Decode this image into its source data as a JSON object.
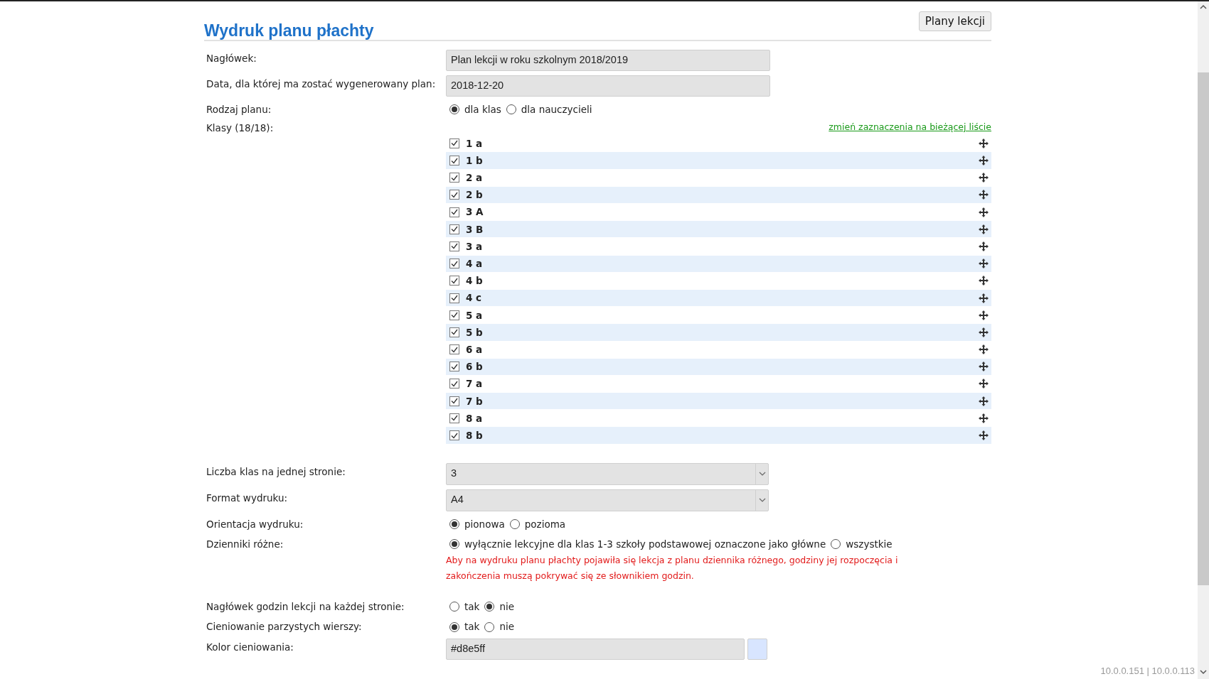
{
  "title": "Wydruk planu płachty",
  "top_button": "Plany lekcji",
  "form": [
    {
      "kind": "text",
      "label": "Nagłówek:",
      "value": "Plan lekcji w roku szkolnym 2018/2019"
    },
    {
      "kind": "text",
      "label": "Data, dla której ma zostać wygenerowany plan:",
      "value": "2018-12-20"
    },
    {
      "kind": "radio",
      "label": "Rodzaj planu:",
      "options": [
        {
          "label": "dla klas",
          "selected": true
        },
        {
          "label": "dla nauczycieli",
          "selected": false
        }
      ]
    },
    {
      "kind": "checklist",
      "label": "Klasy (18/18):",
      "link": "zmień zaznaczenia na bieżącej liście",
      "items": [
        {
          "label": "1 a",
          "checked": true
        },
        {
          "label": "1 b",
          "checked": true
        },
        {
          "label": "2 a",
          "checked": true
        },
        {
          "label": "2 b",
          "checked": true
        },
        {
          "label": "3 A",
          "checked": true
        },
        {
          "label": "3 B",
          "checked": true
        },
        {
          "label": "3 a",
          "checked": true
        },
        {
          "label": "4 a",
          "checked": true
        },
        {
          "label": "4 b",
          "checked": true
        },
        {
          "label": "4 c",
          "checked": true
        },
        {
          "label": "5 a",
          "checked": true
        },
        {
          "label": "5 b",
          "checked": true
        },
        {
          "label": "6 a",
          "checked": true
        },
        {
          "label": "6 b",
          "checked": true
        },
        {
          "label": "7 a",
          "checked": true
        },
        {
          "label": "7 b",
          "checked": true
        },
        {
          "label": "8 a",
          "checked": true
        },
        {
          "label": "8 b",
          "checked": true
        }
      ]
    },
    {
      "kind": "select",
      "label": "Liczba klas na jednej stronie:",
      "value": "3"
    },
    {
      "kind": "select",
      "label": "Format wydruku:",
      "value": "A4"
    },
    {
      "kind": "radio",
      "label": "Orientacja wydruku:",
      "options": [
        {
          "label": "pionowa",
          "selected": true
        },
        {
          "label": "pozioma",
          "selected": false
        }
      ]
    },
    {
      "kind": "radio",
      "label": "Dzienniki różne:",
      "options": [
        {
          "label": "wyłącznie lekcyjne dla klas 1-3 szkoły podstawowej oznaczone jako główne",
          "selected": true
        },
        {
          "label": "wszystkie",
          "selected": false
        }
      ],
      "note": "Aby na wydruku planu płachty pojawiła się lekcja z planu dziennika różnego, godziny jej rozpoczęcia i zakończenia muszą pokrywać się ze słownikiem godzin."
    },
    {
      "kind": "radio",
      "label": "Nagłówek godzin lekcji na każdej stronie:",
      "options": [
        {
          "label": "tak",
          "selected": false
        },
        {
          "label": "nie",
          "selected": true
        }
      ]
    },
    {
      "kind": "radio",
      "label": "Cieniowanie parzystych wierszy:",
      "options": [
        {
          "label": "tak",
          "selected": true
        },
        {
          "label": "nie",
          "selected": false
        }
      ]
    },
    {
      "kind": "color",
      "label": "Kolor cieniowania:",
      "value": "#d8e5ff"
    }
  ],
  "footer": "10.0.0.151 | 10.0.0.113"
}
